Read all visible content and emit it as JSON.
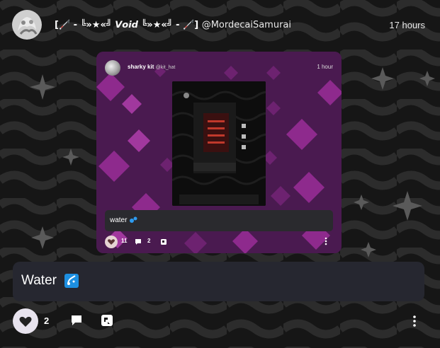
{
  "post": {
    "author_display": "[🦯 - ╚»★«╝ 𝙑𝙤𝙞𝙙 ╚»★«╝ - 🦯]",
    "author_handle": "@MordecaiSamurai",
    "timestamp": "17 hours",
    "caption": "Water",
    "like_count": "2"
  },
  "embed": {
    "author_display": "sharky kit",
    "author_handle": "@kit_hat",
    "timestamp": "1 hour",
    "caption": "water",
    "like_count": "11",
    "comment_count": "2"
  },
  "icons": [
    "avatar-image",
    "heart-icon",
    "comment-icon",
    "repost-icon",
    "more-options-icon",
    "water-emoji-icon",
    "sparkle-icon"
  ],
  "colors": {
    "caption_bg": "#262730",
    "embed_bg": "#4d1b52",
    "diamond": "#8e2a8d",
    "like_btn": "#e8e3ee"
  }
}
